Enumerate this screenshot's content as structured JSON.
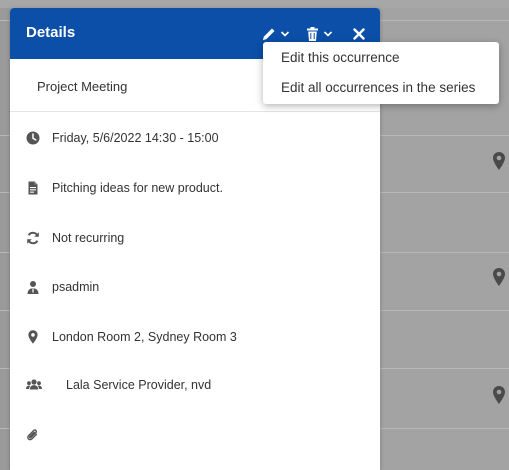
{
  "details": {
    "title": "Details",
    "subject": "Project Meeting",
    "datetime": "Friday, 5/6/2022 14:30 - 15:00",
    "description": "Pitching ideas for new product.",
    "recurrence": "Not recurring",
    "owner": "psadmin",
    "location": "London Room 2, Sydney Room 3",
    "attendees": "Lala Service Provider, nvd"
  },
  "edit_menu": {
    "items": [
      "Edit this occurrence",
      "Edit all occurrences in the series"
    ]
  },
  "colors": {
    "header": "#0b4fa8",
    "icon": "#555555"
  }
}
